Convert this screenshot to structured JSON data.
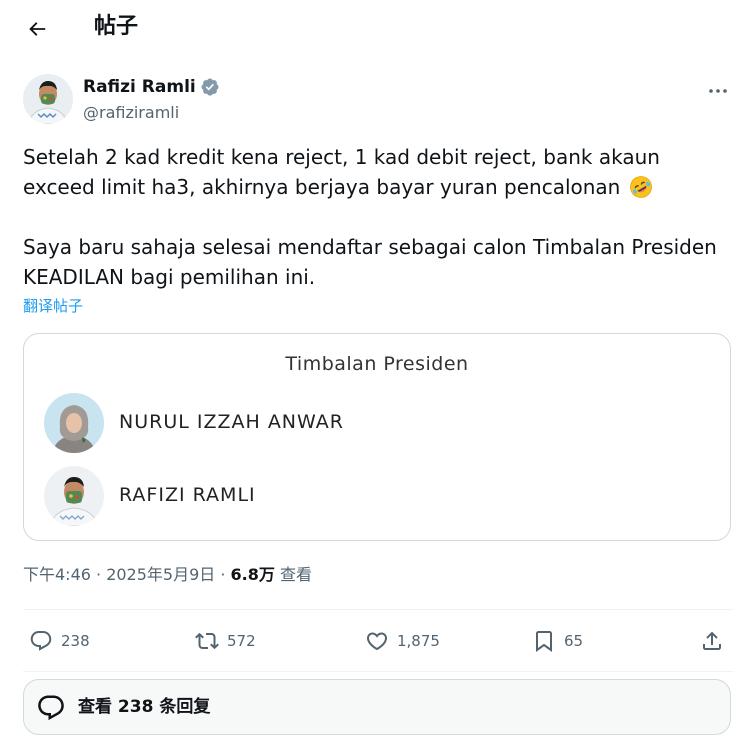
{
  "header": {
    "title": "帖子"
  },
  "author": {
    "name": "Rafizi Ramli",
    "handle": "@rafiziramli"
  },
  "tweet": {
    "line1": "Setelah 2 kad kredit kena reject, 1 kad debit reject, bank akaun exceed limit ha3, akhirnya berjaya bayar yuran pencalonan",
    "line2": "Saya baru sahaja selesai mendaftar sebagai calon Timbalan Presiden KEADILAN bagi pemilihan ini.",
    "emoji": "rolling-on-floor-laughing-icon"
  },
  "translate_label": "翻译帖子",
  "card": {
    "title": "Timbalan Presiden",
    "candidates": [
      {
        "name": "NURUL IZZAH ANWAR"
      },
      {
        "name": "RAFIZI RAMLI"
      }
    ]
  },
  "meta": {
    "time_date": "下午4:46 · 2025年5月9日 · ",
    "views_count": "6.8万",
    "views_label": " 查看"
  },
  "actions": {
    "replies": "238",
    "reposts": "572",
    "likes": "1,875",
    "bookmarks": "65"
  },
  "replies_button": {
    "label": "查看 238 条回复"
  },
  "colors": {
    "accent": "#1d9bf0",
    "text": "#0f1419",
    "muted": "#536471",
    "border": "#cfd9de"
  }
}
